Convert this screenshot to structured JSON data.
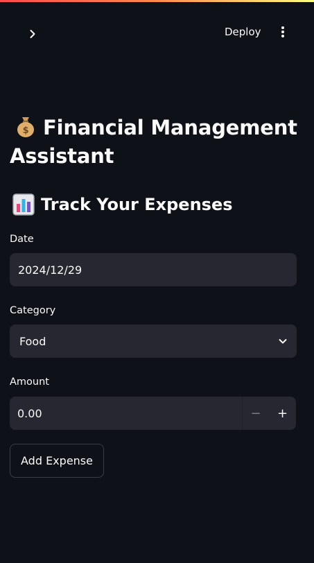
{
  "header": {
    "deploy_label": "Deploy"
  },
  "app": {
    "title": "Financial Management Assistant",
    "subtitle": "Track Your Expenses"
  },
  "form": {
    "date_label": "Date",
    "date_value": "2024/12/29",
    "category_label": "Category",
    "category_value": "Food",
    "amount_label": "Amount",
    "amount_value": "0.00",
    "minus_symbol": "−",
    "plus_symbol": "+",
    "submit_label": "Add Expense"
  },
  "colors": {
    "background": "#0e1117",
    "input_bg": "#262730",
    "text": "#fafafa"
  }
}
